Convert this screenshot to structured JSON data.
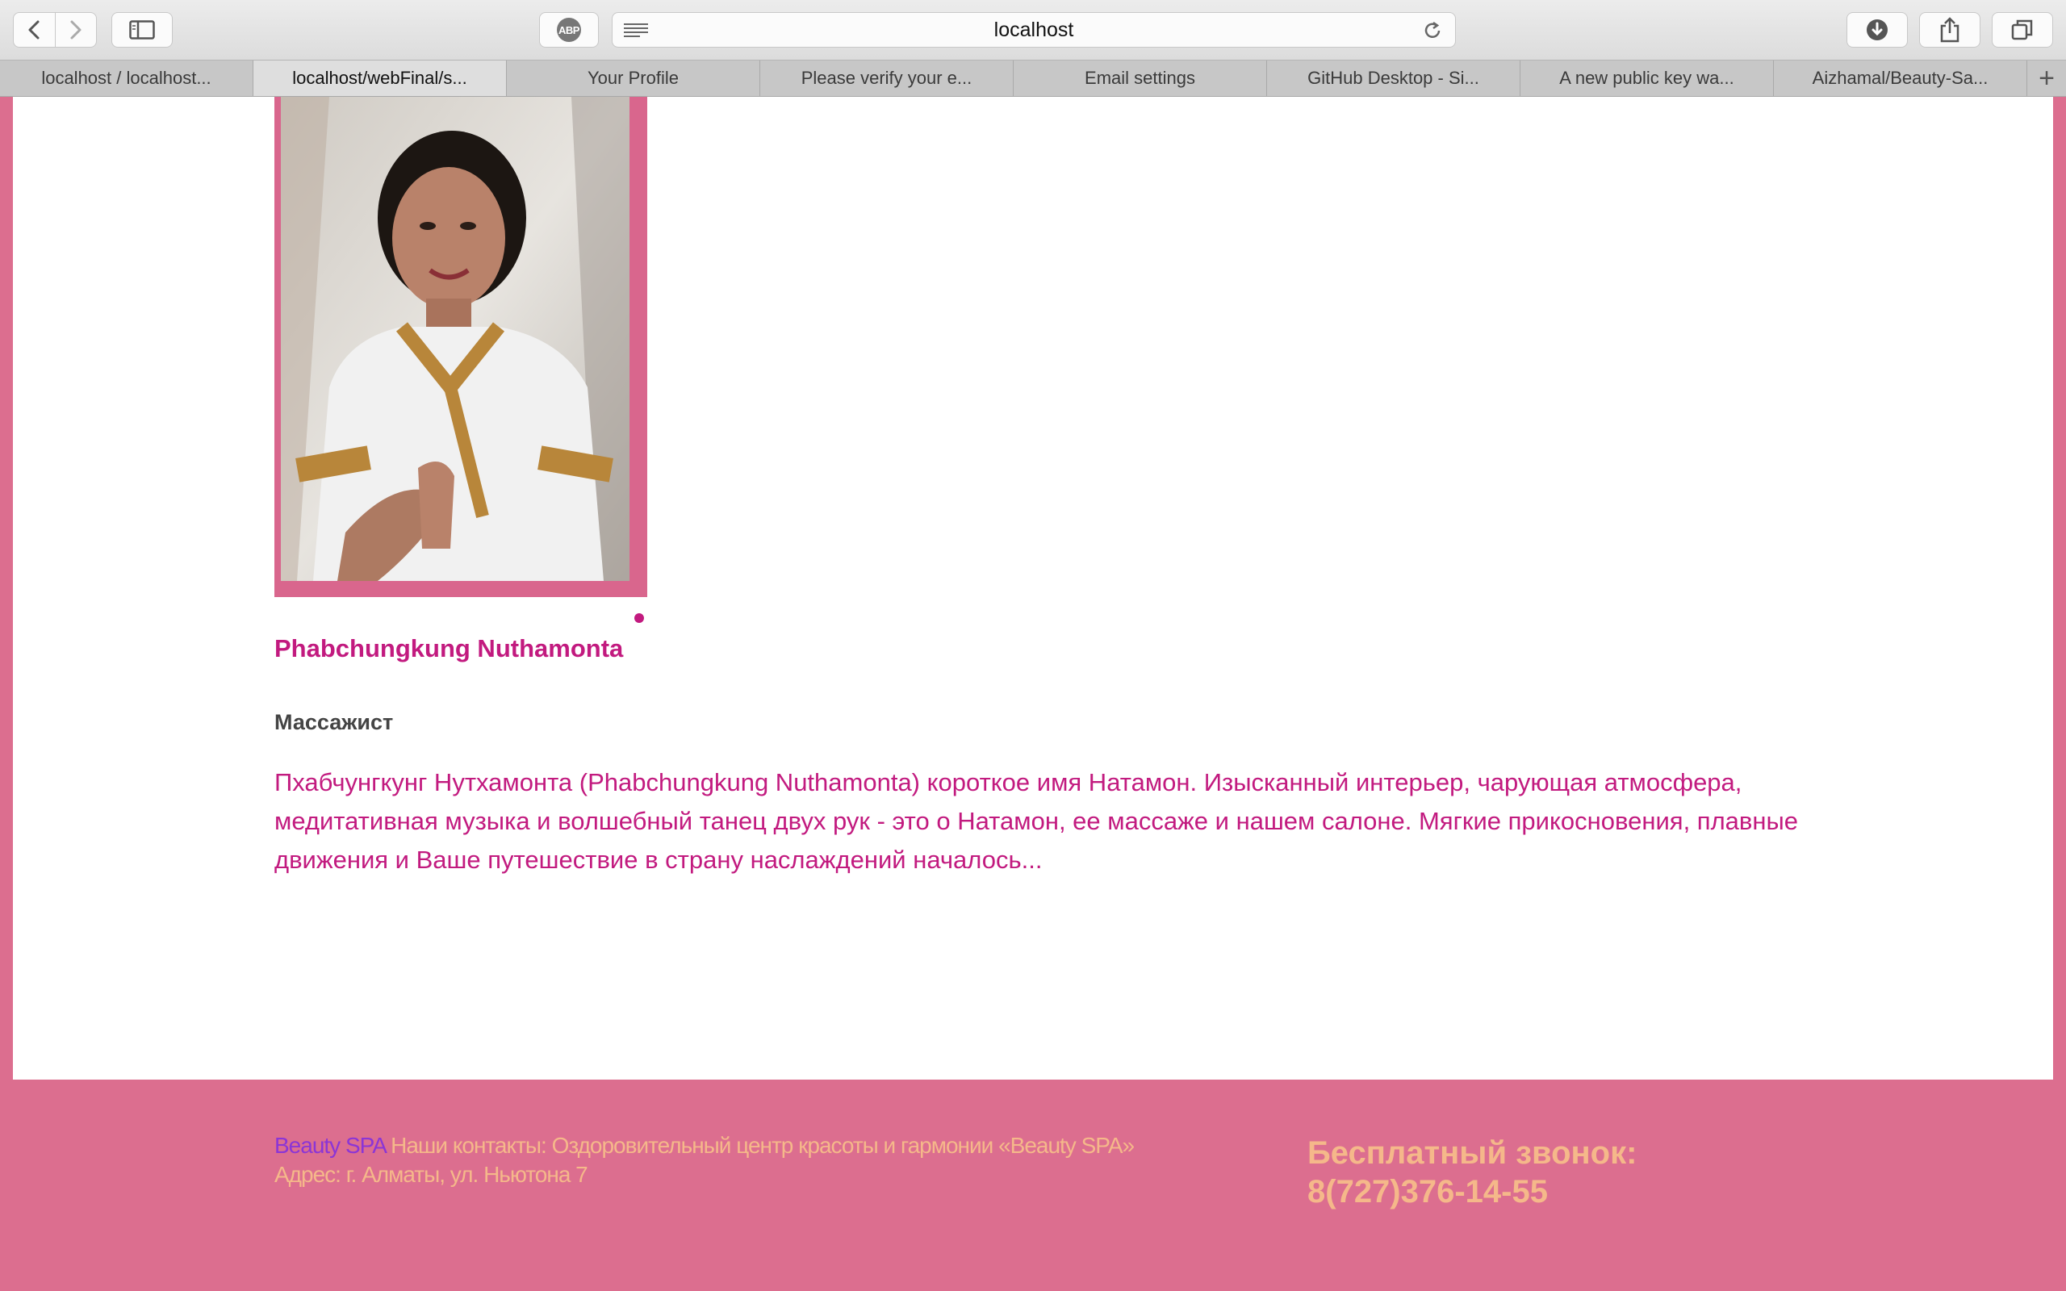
{
  "browser": {
    "url": "localhost",
    "adblock_label": "ABP",
    "tabs": [
      {
        "label": "localhost / localhost..."
      },
      {
        "label": "localhost/webFinal/s..."
      },
      {
        "label": "Your Profile"
      },
      {
        "label": "Please verify your e..."
      },
      {
        "label": "Email settings"
      },
      {
        "label": "GitHub Desktop - Si..."
      },
      {
        "label": "A new public key wa..."
      },
      {
        "label": "Aizhamal/Beauty-Sa..."
      }
    ],
    "new_tab_label": "+"
  },
  "page": {
    "specialist": {
      "name": "Phabchungkung Nuthamonta",
      "role": "Массажист",
      "description": "Пхабчунгкунг Нутхамонта (Phabchungkung Nuthamonta) короткое имя Натамон. Изысканный интерьер, чарующая атмосфера, медитативная музыка и волшебный танец двух рук - это о Натамон, ее массаже и нашем салоне. Мягкие прикосновения, плавные движения и Ваше путешествие в страну наслаждений началось..."
    }
  },
  "footer": {
    "brand": "Beauty SPA",
    "contacts": "Наши контакты: Оздоровительный центр красоты и гармонии «Beauty SPA»",
    "address": "Адрес: г. Алматы, ул. Ньютона 7",
    "free_call_label": "Бесплатный звонок:",
    "phone": "8(727)376-14-55"
  },
  "colors": {
    "page_background": "#dc6e8f",
    "accent_magenta": "#c21a7f",
    "footer_text": "#f5b88a",
    "brand_purple": "#8b35d6"
  }
}
